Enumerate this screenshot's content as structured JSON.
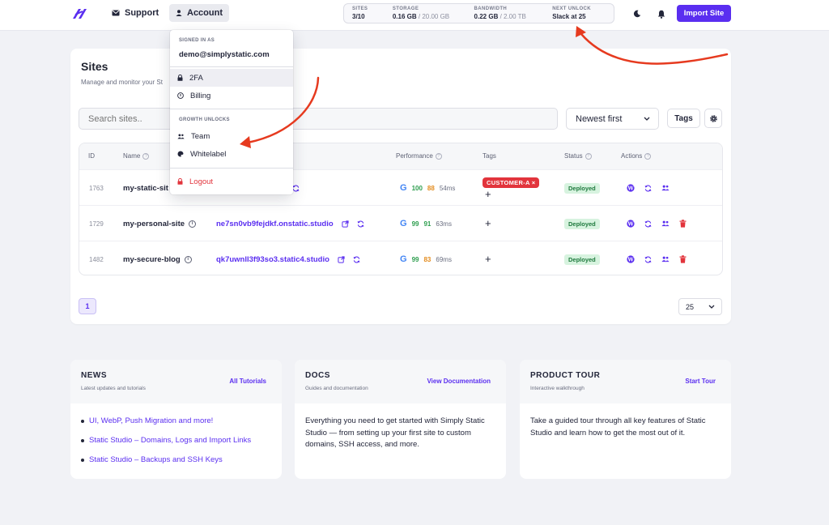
{
  "header": {
    "nav": {
      "support": "Support",
      "account": "Account"
    },
    "stats": [
      {
        "label": "SITES",
        "value": "3/10",
        "muted": ""
      },
      {
        "label": "STORAGE",
        "value": "0.16 GB",
        "muted": " / 20.00 GB"
      },
      {
        "label": "BANDWIDTH",
        "value": "0.22 GB",
        "muted": " / 2.00 TB"
      },
      {
        "label": "NEXT UNLOCK",
        "value": "Slack at 25",
        "muted": ""
      }
    ],
    "import_label": "Import Site"
  },
  "account_menu": {
    "signed_in_label": "SIGNED IN AS",
    "email": "demo@simplystatic.com",
    "items": [
      "2FA",
      "Billing"
    ],
    "growth_label": "GROWTH UNLOCKS",
    "growth_items": [
      "Team",
      "Whitelabel"
    ],
    "logout": "Logout"
  },
  "sites": {
    "title": "Sites",
    "subtitle": "Manage and monitor your St",
    "search_placeholder": "Search sites..",
    "sort_value": "Newest first",
    "tags_label": "Tags",
    "columns": [
      "ID",
      "Name",
      "Performance",
      "Tags",
      "Status",
      "Actions"
    ],
    "rows": [
      {
        "id": "1763",
        "name": "my-static-sit",
        "domain": "",
        "g": "G",
        "s1": "100",
        "s2": "88",
        "ms": "54ms",
        "tag": "CUSTOMER-A ×",
        "status": "Deployed"
      },
      {
        "id": "1729",
        "name": "my-personal-site",
        "domain": "ne7sn0vb9fejdkf.onstatic.studio",
        "g": "G",
        "s1": "99",
        "s2": "91",
        "ms": "63ms",
        "tag": "",
        "status": "Deployed"
      },
      {
        "id": "1482",
        "name": "my-secure-blog",
        "domain": "qk7uwnll3f93so3.static4.studio",
        "g": "G",
        "s1": "99",
        "s2": "83",
        "ms": "69ms",
        "tag": "",
        "status": "Deployed"
      }
    ],
    "page": "1",
    "per_page": "25"
  },
  "cards": {
    "news": {
      "title": "NEWS",
      "subtitle": "Latest updates and tutorials",
      "link": "All Tutorials",
      "items": [
        "UI, WebP, Push Migration and more!",
        "Static Studio – Domains, Logs and Import Links",
        "Static Studio – Backups and SSH Keys"
      ]
    },
    "docs": {
      "title": "DOCS",
      "subtitle": "Guides and documentation",
      "link": "View Documentation",
      "text": "Everything you need to get started with Simply Static Studio — from setting up your first site to custom domains, SSH access, and more."
    },
    "tour": {
      "title": "PRODUCT TOUR",
      "subtitle": "Interactive walkthrough",
      "link": "Start Tour",
      "text": "Take a guided tour through all key features of Static Studio and learn how to get the most out of it."
    }
  },
  "colors": {
    "accent": "#5a2ef0",
    "danger": "#e2343c",
    "success": "#1f7a3e"
  }
}
